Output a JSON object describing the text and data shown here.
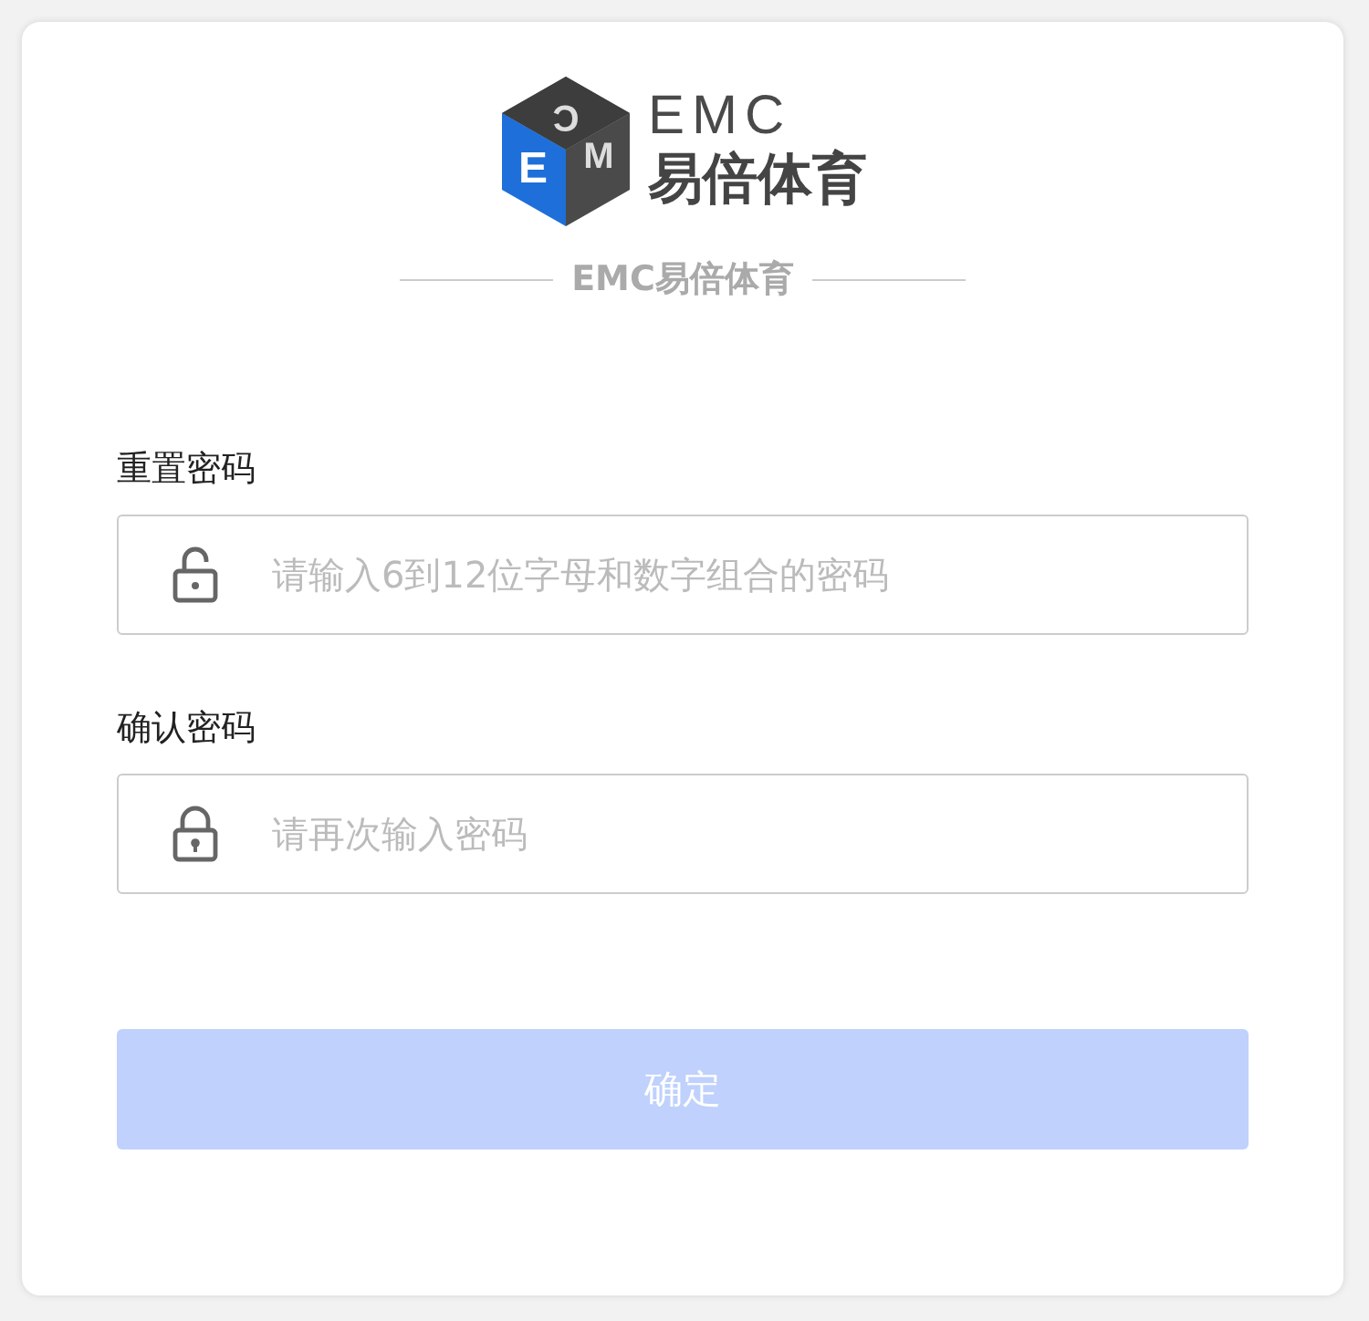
{
  "logo": {
    "cube_letters": [
      "E",
      "M",
      "C"
    ],
    "wordmark": "EMC",
    "name": "易倍体育"
  },
  "brand_divider": "EMC易倍体育",
  "fields": [
    {
      "label": "重置密码",
      "placeholder": "请输入6到12位字母和数字组合的密码",
      "kind": "unlocked"
    },
    {
      "label": "确认密码",
      "placeholder": "请再次输入密码",
      "kind": "locked"
    }
  ],
  "submit": {
    "label": "确定",
    "disabled": true
  }
}
